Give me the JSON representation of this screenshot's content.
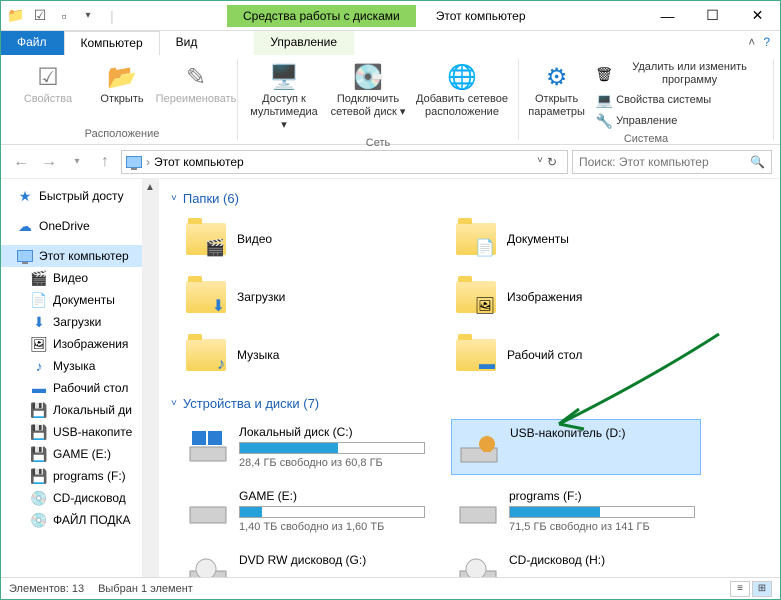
{
  "window": {
    "context_tab": "Средства работы с дисками",
    "title": "Этот компьютер"
  },
  "ribbon_tabs": {
    "file": "Файл",
    "computer": "Компьютер",
    "view": "Вид",
    "manage": "Управление"
  },
  "ribbon": {
    "group_location": "Расположение",
    "properties": "Свойства",
    "open": "Открыть",
    "rename": "Переименовать",
    "group_network": "Сеть",
    "media_access": "Доступ к мультимедиа ▾",
    "map_drive": "Подключить сетевой диск ▾",
    "add_network": "Добавить сетевое расположение",
    "group_system": "Система",
    "open_settings": "Открыть параметры",
    "uninstall": "Удалить или изменить программу",
    "sys_props": "Свойства системы",
    "manage": "Управление"
  },
  "address": {
    "path": "Этот компьютер"
  },
  "search": {
    "placeholder": "Поиск: Этот компьютер"
  },
  "sidebar": {
    "quick": "Быстрый досту",
    "onedrive": "OneDrive",
    "thispc": "Этот компьютер",
    "video": "Видео",
    "documents": "Документы",
    "downloads": "Загрузки",
    "pictures": "Изображения",
    "music": "Музыка",
    "desktop": "Рабочий стол",
    "localdisk": "Локальный ди",
    "usb": "USB-накопите",
    "game": "GAME (E:)",
    "programs": "programs (F:)",
    "cddrive": "CD-дисковод",
    "filepodka": "ФАЙЛ ПОДКА"
  },
  "sections": {
    "folders": "Папки (6)",
    "devices": "Устройства и диски (7)"
  },
  "folders": {
    "video": "Видео",
    "documents": "Документы",
    "downloads": "Загрузки",
    "pictures": "Изображения",
    "music": "Музыка",
    "desktop": "Рабочий стол"
  },
  "drives": {
    "c": {
      "name": "Локальный диск (C:)",
      "sub": "28,4 ГБ свободно из 60,8 ГБ",
      "fill": 53
    },
    "d": {
      "name": "USB-накопитель (D:)",
      "sub": ""
    },
    "e": {
      "name": "GAME (E:)",
      "sub": "1,40 ТБ свободно из 1,60 ТБ",
      "fill": 12
    },
    "f": {
      "name": "programs (F:)",
      "sub": "71,5 ГБ свободно из 141 ГБ",
      "fill": 49
    },
    "g": {
      "name": "DVD RW дисковод (G:)",
      "sub": ""
    },
    "h": {
      "name": "CD-дисковод (H:)",
      "sub": ""
    }
  },
  "status": {
    "count": "Элементов: 13",
    "selected": "Выбран 1 элемент"
  }
}
